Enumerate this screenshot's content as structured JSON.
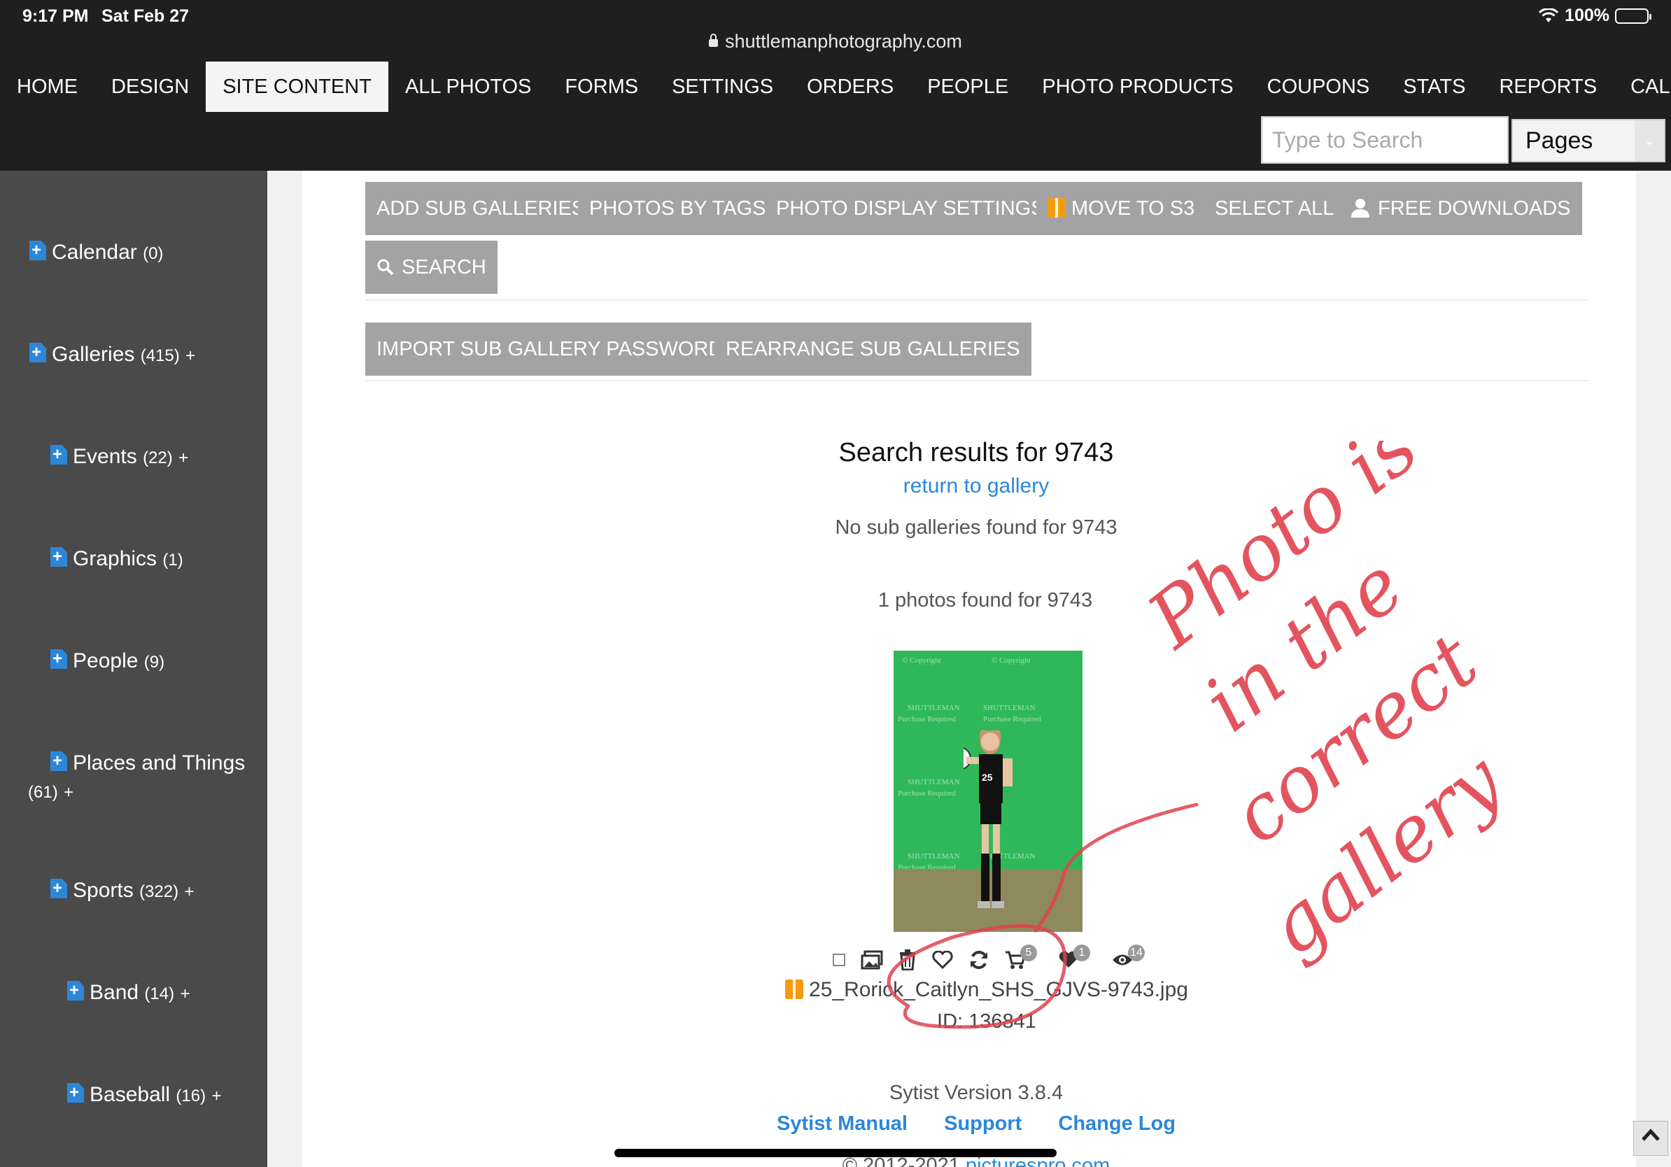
{
  "status_bar": {
    "time": "9:17 PM",
    "date": "Sat Feb 27",
    "battery": "100%"
  },
  "browser": {
    "url": "shuttlemanphotography.com"
  },
  "nav": {
    "items": [
      "HOME",
      "DESIGN",
      "SITE CONTENT",
      "ALL PHOTOS",
      "FORMS",
      "SETTINGS",
      "ORDERS",
      "PEOPLE",
      "PHOTO PRODUCTS",
      "COUPONS",
      "STATS",
      "REPORTS",
      "CALENDAR"
    ],
    "active": "SITE CONTENT",
    "search_placeholder": "Type to Search",
    "select_value": "Pages"
  },
  "sidebar": {
    "items": [
      {
        "label": "Calendar",
        "count": "(0)",
        "suffix": ""
      },
      {
        "label": "Galleries",
        "count": "(415)",
        "suffix": "+"
      },
      {
        "label": "Events",
        "count": "(22)",
        "suffix": "+"
      },
      {
        "label": "Graphics",
        "count": "(1)",
        "suffix": ""
      },
      {
        "label": "People",
        "count": "(9)",
        "suffix": ""
      },
      {
        "label": "Places and Things",
        "count": "(61)",
        "suffix": "+"
      },
      {
        "label": "Sports",
        "count": "(322)",
        "suffix": "+"
      },
      {
        "label": "Band",
        "count": "(14)",
        "suffix": "+"
      },
      {
        "label": "Baseball",
        "count": "(16)",
        "suffix": "+"
      }
    ]
  },
  "toolbar": {
    "add_sub_galleries": "ADD SUB GALLERIES",
    "photos_by_tags": "PHOTOS BY TAGS",
    "photo_display_settings": "PHOTO DISPLAY SETTINGS",
    "move_to_s3": "MOVE TO S3",
    "select_all": "SELECT ALL",
    "free_downloads": "FREE DOWNLOADS",
    "search": "SEARCH",
    "import_passwords": "IMPORT SUB GALLERY PASSWORDS",
    "rearrange": "REARRANGE SUB GALLERIES"
  },
  "results": {
    "title": "Search results for 9743",
    "return_link": "return to gallery",
    "no_sub_galleries": "No sub galleries found for 9743",
    "photos_found": "1 photos found for 9743",
    "photo": {
      "filename": "25_Rorick_Caitlyn_SHS_GJVS-9743.jpg",
      "id_text": "ID: 136841",
      "cart_count": "5",
      "favorite_count": "1",
      "views_count": "14",
      "watermark_copyright": "© Copyright",
      "watermark_brand": "SHUTTLEMAN",
      "watermark_purchase": "Purchase Required",
      "jersey_number": "25"
    }
  },
  "footer": {
    "version": "Sytist Version 3.8.4",
    "links": [
      "Sytist Manual",
      "Support",
      "Change Log"
    ],
    "copyright_prefix": "© 2012-2021",
    "copyright_link": "picturespro.com"
  },
  "annotation": {
    "text": [
      "Photo is",
      "in the",
      "correct",
      "gallery"
    ],
    "color": "#e0424e"
  },
  "colors": {
    "nav_bg": "#1f1f1f",
    "sidebar_bg": "#4a4a4a",
    "button_bg": "#a3a3a3",
    "link": "#2c87d9",
    "accent_orange": "#f39c12"
  }
}
